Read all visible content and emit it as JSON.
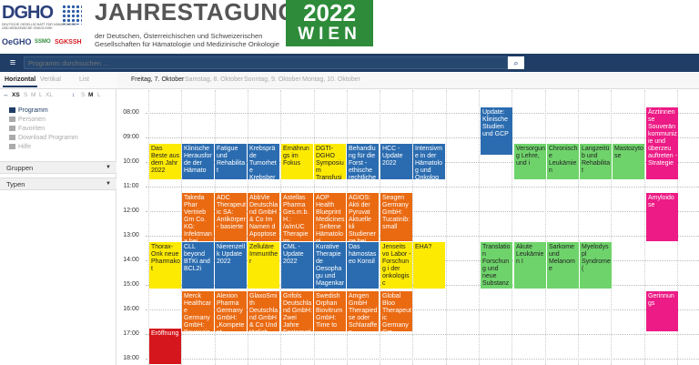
{
  "header": {
    "dgho_logo": "DGHO",
    "dgho_sub": "DEUTSCHE GESELLSCHAFT FÜR HÄMATOLOGIE UND MEDIZINISCHE ONKOLOGIE",
    "partner_1": "OeGHO",
    "partner_2": "SSMO",
    "partner_3": "SGKSSH",
    "title": "JAHRESTAGUNG",
    "subtitle_1": "der Deutschen, Österreichischen und Schweizerischen",
    "subtitle_2": "Gesellschaften für Hämatologie und Medizinische Onkologie",
    "event_year": "2022",
    "event_city": "WIEN"
  },
  "topbar": {
    "menu_icon": "≡",
    "search_placeholder": "Programm durchsuchen ...",
    "search_icon": "⌕"
  },
  "sidebar": {
    "tabs": {
      "horizontal": "Horizontal",
      "vertical": "Vertikal",
      "list": "List"
    },
    "size_labels": [
      "XS",
      "S",
      "M",
      "L",
      "XL"
    ],
    "size_labels_2": [
      "S",
      "M",
      "L"
    ],
    "nav": [
      "Programm",
      "Personen",
      "Favoriten",
      "Download Programm",
      "Hilfe"
    ],
    "filters": [
      "Gruppen",
      "Typen"
    ]
  },
  "days": [
    "Freitag, 7. Oktober",
    "Samstag, 8. Oktober",
    "Sonntag, 9. Oktober",
    "Montag, 10. Oktober"
  ],
  "hours": [
    "08:00",
    "09:00",
    "10:00",
    "11:00",
    "12:00",
    "13:00",
    "14:00",
    "15:00",
    "16:00",
    "17:00",
    "18:00"
  ],
  "events": [
    {
      "t": "Update: Klinische Studien und GCP",
      "c": "blue"
    },
    {
      "t": "Ärztinnense Souverän kommunizie und überzeu auftreten - Strategie",
      "c": "magenta"
    },
    {
      "t": "Das Beste aus dem Jahr 2022",
      "c": "yellow"
    },
    {
      "t": "Klinische Herausforde der Hämato",
      "c": "blue"
    },
    {
      "t": "Fatigue und Rehabilitat",
      "c": "blue"
    },
    {
      "t": "Krebspräde Tumorhete Krebsberat",
      "c": "blue"
    },
    {
      "t": "Ernährungs im Fokus",
      "c": "yellow"
    },
    {
      "t": "DGTI-DGHO Symposium Transfusion",
      "c": "yellow"
    },
    {
      "t": "Behandlung für die Forst - ethische rechtliche A",
      "c": "blue"
    },
    {
      "t": "HCC - Update 2022",
      "c": "blue"
    },
    {
      "t": "Intensivme in der Hämatolog und Onkolog",
      "c": "blue"
    },
    {
      "t": "Versorgung Lehre, und i",
      "c": "green"
    },
    {
      "t": "Chronische Leukämien",
      "c": "green"
    },
    {
      "t": "Langzeitüb und Rehabilitat",
      "c": "green"
    },
    {
      "t": "Mastozytose",
      "c": "green"
    },
    {
      "t": "Takeda Phar Vertrieb Gm Co. KG: Infektmana bei Patiente",
      "c": "orange"
    },
    {
      "t": "ADC Therapeutic SA: Antikörper- basierte",
      "c": "orange"
    },
    {
      "t": "AbbVie Deutschland GmbH & Co Im Namen d Apoptose -",
      "c": "orange"
    },
    {
      "t": "Astellas Pharma Ges.m.b.H.: /a/mUC Therapie im",
      "c": "orange"
    },
    {
      "t": "AOP Health Blueprint Medicines: Seltene Hämatologi",
      "c": "orange"
    },
    {
      "t": "AGIOS: Akti der Pyruvat Aktuelle kli Studienerge bei Hämatol",
      "c": "orange"
    },
    {
      "t": "Seagen Germany GmbH: Tucatinib: small",
      "c": "orange"
    },
    {
      "t": "Amyloidose",
      "c": "magenta"
    },
    {
      "t": "Thorax-Onk neue Pharmakot",
      "c": "yellow"
    },
    {
      "t": "CLL beyond BTKi and BCL2i",
      "c": "blue"
    },
    {
      "t": "Nierenzellk Update 2022",
      "c": "blue"
    },
    {
      "t": "Zelluläre Immunther",
      "c": "yellow"
    },
    {
      "t": "CML - Update 2022",
      "c": "blue"
    },
    {
      "t": "Kurative Therapie de Oesophagu und Magenkarzi",
      "c": "blue"
    },
    {
      "t": "Das hämostaseo Konsil",
      "c": "blue"
    },
    {
      "t": "Jenseits vo Labor - Forschung i der onkologisc",
      "c": "yellow"
    },
    {
      "t": "EHA?",
      "c": "yellow"
    },
    {
      "t": "Translation Forschung und neue Substanzen",
      "c": "green"
    },
    {
      "t": "Akute Leukämien I",
      "c": "green"
    },
    {
      "t": "Sarkome und Melanome",
      "c": "green"
    },
    {
      "t": "Myelodyspl Syndrome (",
      "c": "green"
    },
    {
      "t": "Merck Healthcare Germany GmbH: Bavencio",
      "c": "orange"
    },
    {
      "t": "Alexion Pharma Germany GmbH: „Kompetent",
      "c": "orange"
    },
    {
      "t": "GlaxoSmith Deutschland GmbH & Co Und täglich grüßt das Immunsyste",
      "c": "orange"
    },
    {
      "t": "Grifols Deutschland GmbH: Zwei Jahre Fostamatini",
      "c": "orange"
    },
    {
      "t": "Swedish Orphan Biovitrum GmbH: Time to",
      "c": "orange"
    },
    {
      "t": "Amgen GmbH Therapiedse oder Schlaraffen Praxisrelev",
      "c": "orange"
    },
    {
      "t": "Global Bloo Therapeutic Germany Gm Therapie de Sichelzellk",
      "c": "orange"
    },
    {
      "t": "Gerinnungs",
      "c": "magenta"
    },
    {
      "t": "Eröffnung",
      "c": "red"
    }
  ]
}
